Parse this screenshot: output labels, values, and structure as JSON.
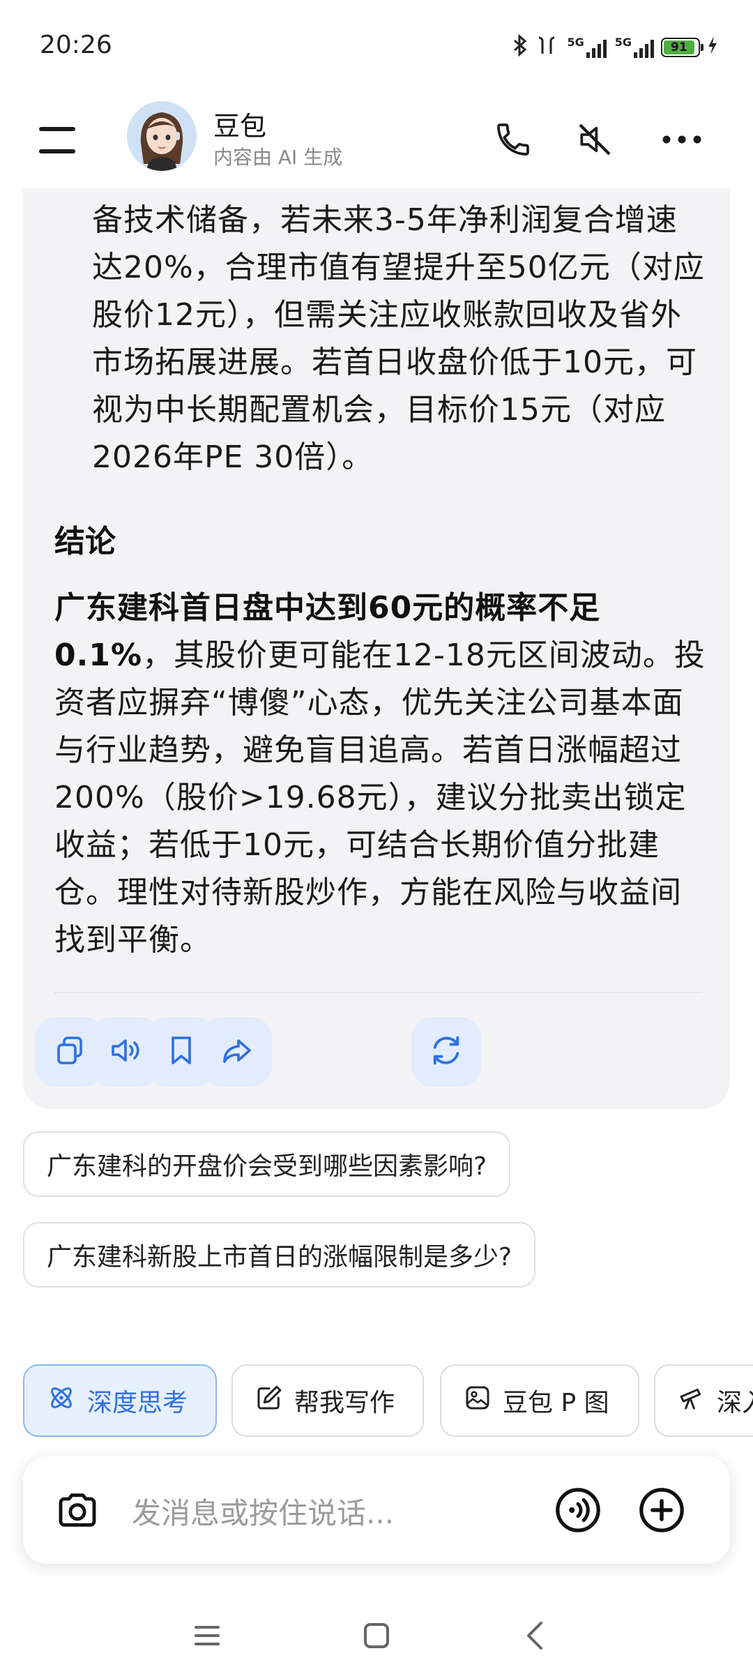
{
  "status_bar": {
    "time": "20:26",
    "network": "5G",
    "battery_percent": "91"
  },
  "header": {
    "bot_name": "豆包",
    "subtitle": "内容由 AI 生成"
  },
  "answer": {
    "paragraph_1": "备技术储备，若未来3-5年净利润复合增速达20%，合理市值有望提升至50亿元（对应股价12元），但需关注应收账款回收及省外市场拓展进展。若首日收盘价低于10元，可视为中长期配置机会，目标价15元（对应2026年PE 30倍）。",
    "conclusion_heading": "结论",
    "conclusion_bold": "广东建科首日盘中达到60元的概率不足0.1%",
    "conclusion_body": "，其股价更可能在12-18元区间波动。投资者应摒弃“博傻”心态，优先关注公司基本面与行业趋势，避免盲目追高。若首日涨幅超过200%（股价>19.68元），建议分批卖出锁定收益；若低于10元，可结合长期价值分批建仓。理性对待新股炒作，方能在风险与收益间找到平衡。"
  },
  "suggestions": [
    "广东建科的开盘价会受到哪些因素影响?",
    "广东建科新股上市首日的涨幅限制是多少?"
  ],
  "tools": [
    {
      "label": "深度思考",
      "icon": "atom-icon",
      "active": true
    },
    {
      "label": "帮我写作",
      "icon": "edit-icon",
      "active": false
    },
    {
      "label": "豆包 P 图",
      "icon": "image-edit-icon",
      "active": false
    },
    {
      "label": "深入",
      "icon": "telescope-icon",
      "active": false
    }
  ],
  "input": {
    "placeholder": "发消息或按住说话..."
  },
  "colors": {
    "accent": "#2f6fe0",
    "card_bg": "#f3f3f5",
    "action_bg": "#e2ecfc"
  }
}
